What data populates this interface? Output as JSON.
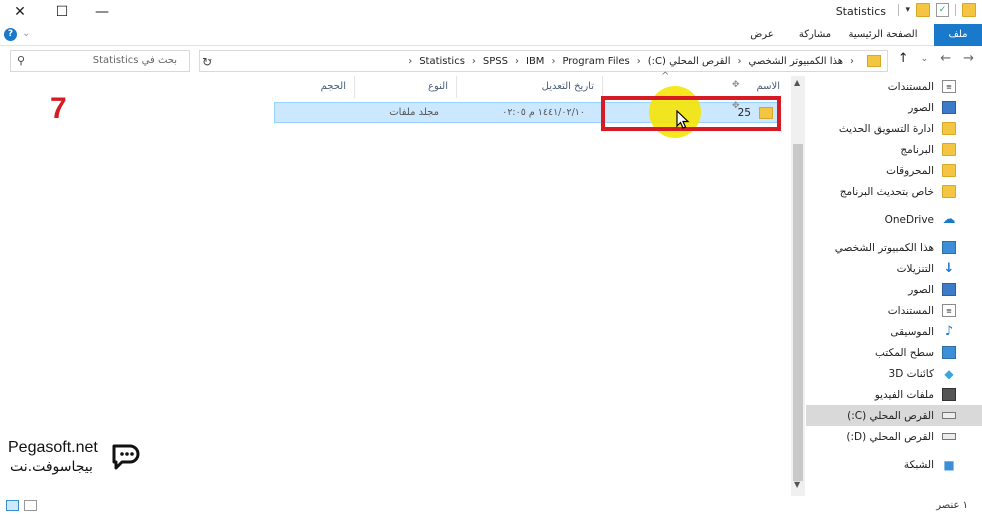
{
  "window": {
    "title": "Statistics",
    "close_glyph": "✕",
    "max_glyph": "☐",
    "min_glyph": "—"
  },
  "ribbon": {
    "tabs": [
      "ملف",
      "الصفحة الرئيسية",
      "مشاركة",
      "عرض"
    ]
  },
  "address": {
    "crumbs": [
      "هذا الكمبيوتر الشخصي",
      "القرص المحلي (C:)",
      "Program Files",
      "IBM",
      "SPSS",
      "Statistics"
    ],
    "separator": "‹"
  },
  "search": {
    "placeholder": "بحث في Statistics"
  },
  "columns": {
    "name": "الاسم",
    "date": "تاريخ التعديل",
    "type": "النوع",
    "size": "الحجم"
  },
  "files": [
    {
      "name": "25",
      "date": "١٤٤١/٠٢/١٠ م ٠٢:٠٥",
      "type": "مجلد ملفات",
      "size": ""
    }
  ],
  "nav_pane": {
    "items": [
      {
        "label": "المستندات",
        "icon": "documents-icon",
        "pinned": true
      },
      {
        "label": "الصور",
        "icon": "pictures-icon",
        "pinned": true
      },
      {
        "label": "ادارة التسويق الحديث",
        "icon": "folder-icon"
      },
      {
        "label": "البرنامج",
        "icon": "folder-icon"
      },
      {
        "label": "المحروقات",
        "icon": "folder-icon"
      },
      {
        "label": "خاص بتحديث البرنامج",
        "icon": "folder-icon"
      },
      {
        "label": "OneDrive",
        "icon": "onedrive-icon"
      },
      {
        "label": "هذا الكمبيوتر الشخصي",
        "icon": "computer-icon"
      },
      {
        "label": "التنزيلات",
        "icon": "downloads-icon"
      },
      {
        "label": "الصور",
        "icon": "pictures-icon"
      },
      {
        "label": "المستندات",
        "icon": "documents-icon"
      },
      {
        "label": "الموسيقى",
        "icon": "music-icon"
      },
      {
        "label": "سطح المكتب",
        "icon": "desktop-icon"
      },
      {
        "label": "كائنات 3D",
        "icon": "3d-objects-icon"
      },
      {
        "label": "ملفات الفيديو",
        "icon": "videos-icon"
      },
      {
        "label": "القرص المحلي (C:)",
        "icon": "drive-icon",
        "selected": true
      },
      {
        "label": "القرص المحلي (D:)",
        "icon": "drive-icon"
      },
      {
        "label": "الشبكة",
        "icon": "network-icon"
      }
    ]
  },
  "status": {
    "item_count": "١ عنصر"
  },
  "overlay": {
    "step_number": "7"
  },
  "watermark": {
    "latin": "Pegasoft.net",
    "arabic": "بيجاسوفت.نت"
  },
  "colors": {
    "accent": "#1979ca",
    "selection": "#cce8ff",
    "highlight_box": "#d71b22",
    "spotlight": "#f5e400"
  }
}
